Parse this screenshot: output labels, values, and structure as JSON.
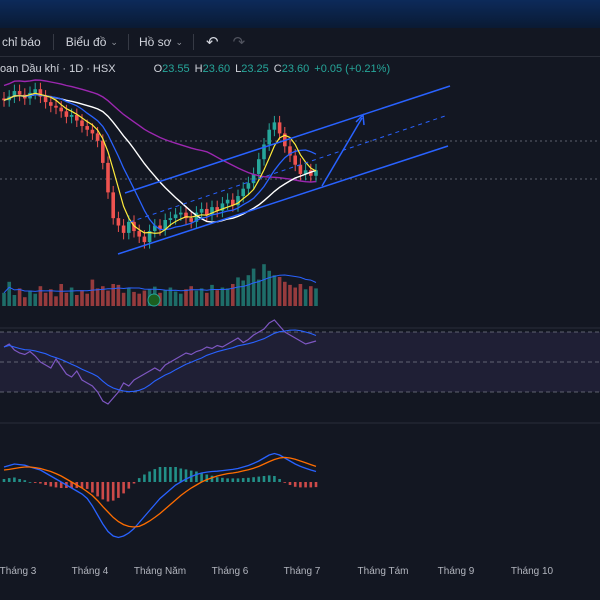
{
  "toolbar": {
    "indicators_label": "chỉ báo",
    "chart_label": "Biểu đồ",
    "profile_label": "Hồ sơ",
    "undo_icon": "undo-icon",
    "redo_icon": "redo-icon"
  },
  "legend": {
    "symbol": "oan Dầu khí · 1D · HSX",
    "o_label": "O",
    "o_value": "23.55",
    "h_label": "H",
    "h_value": "23.60",
    "l_label": "L",
    "l_value": "23.25",
    "c_label": "C",
    "c_value": "23.60",
    "change": "+0.05 (+0.21%)"
  },
  "colors": {
    "background": "#131722",
    "up": "#26a69a",
    "down": "#ef5350",
    "ma_fast": "#ffeb3b",
    "ma_mid": "#2962ff",
    "ma_slow": "#ffffff",
    "ma_long": "#9c27b0",
    "channel": "#2962ff",
    "rsi": "#7e57c2",
    "macd": "#2962ff",
    "signal": "#ff6d00"
  },
  "chart_data": {
    "type": "candlestick",
    "x_ticks": [
      "Tháng 3",
      "Tháng 4",
      "Tháng Năm",
      "Tháng 6",
      "Tháng 7",
      "Tháng Tám",
      "Tháng 9",
      "Tháng 10"
    ],
    "closes": [
      27.4,
      27.6,
      27.9,
      27.7,
      27.5,
      27.8,
      28.0,
      27.6,
      27.3,
      27.1,
      27.0,
      26.8,
      26.5,
      26.6,
      26.3,
      26.0,
      25.8,
      25.6,
      25.2,
      24.0,
      22.4,
      21.0,
      20.6,
      20.2,
      20.8,
      20.3,
      20.0,
      19.7,
      20.3,
      20.6,
      20.4,
      20.9,
      21.0,
      21.2,
      21.3,
      21.0,
      20.8,
      21.3,
      21.5,
      21.2,
      21.6,
      21.4,
      21.8,
      22.0,
      21.7,
      22.2,
      22.6,
      22.9,
      23.4,
      24.2,
      25.0,
      25.8,
      26.2,
      25.6,
      24.9,
      24.4,
      23.9,
      23.4,
      23.6,
      23.3,
      23.6
    ],
    "volume": [
      30,
      55,
      25,
      40,
      20,
      35,
      28,
      45,
      30,
      38,
      22,
      50,
      30,
      42,
      25,
      36,
      28,
      60,
      40,
      45,
      35,
      50,
      48,
      30,
      40,
      32,
      28,
      35,
      38,
      44,
      30,
      36,
      42,
      33,
      28,
      38,
      45,
      35,
      40,
      30,
      48,
      36,
      42,
      40,
      50,
      65,
      58,
      70,
      85,
      60,
      95,
      80,
      70,
      66,
      55,
      48,
      42,
      50,
      38,
      45,
      40
    ],
    "rsi": [
      60,
      62,
      58,
      56,
      55,
      57,
      54,
      50,
      48,
      46,
      52,
      47,
      42,
      40,
      44,
      38,
      36,
      34,
      30,
      24,
      22,
      26,
      30,
      36,
      34,
      38,
      40,
      42,
      44,
      46,
      44,
      48,
      50,
      52,
      54,
      56,
      55,
      57,
      58,
      60,
      59,
      61,
      60,
      62,
      64,
      66,
      63,
      65,
      68,
      70,
      72,
      76,
      78,
      74,
      70,
      68,
      66,
      64,
      62,
      63,
      64
    ],
    "macd": [
      0.5,
      0.55,
      0.6,
      0.58,
      0.56,
      0.5,
      0.45,
      0.4,
      0.3,
      0.2,
      0.1,
      0,
      -0.1,
      -0.2,
      -0.3,
      -0.4,
      -0.55,
      -0.8,
      -1.1,
      -1.4,
      -1.65,
      -1.8,
      -1.85,
      -1.8,
      -1.7,
      -1.55,
      -1.35,
      -1.15,
      -0.95,
      -0.75,
      -0.55,
      -0.4,
      -0.25,
      -0.1,
      0,
      0.1,
      0.18,
      0.25,
      0.3,
      0.33,
      0.35,
      0.36,
      0.38,
      0.4,
      0.42,
      0.45,
      0.5,
      0.55,
      0.62,
      0.7,
      0.8,
      0.9,
      0.95,
      0.9,
      0.8,
      0.7,
      0.6,
      0.52,
      0.46,
      0.4,
      0.35
    ],
    "signal": [
      0.4,
      0.42,
      0.45,
      0.48,
      0.5,
      0.5,
      0.48,
      0.45,
      0.4,
      0.35,
      0.28,
      0.2,
      0.1,
      0,
      -0.1,
      -0.2,
      -0.32,
      -0.45,
      -0.62,
      -0.82,
      -1.0,
      -1.18,
      -1.32,
      -1.42,
      -1.48,
      -1.5,
      -1.48,
      -1.4,
      -1.3,
      -1.18,
      -1.05,
      -0.9,
      -0.75,
      -0.6,
      -0.45,
      -0.32,
      -0.2,
      -0.1,
      0,
      0.08,
      0.14,
      0.2,
      0.24,
      0.28,
      0.3,
      0.33,
      0.37,
      0.41,
      0.46,
      0.52,
      0.6,
      0.68,
      0.75,
      0.8,
      0.82,
      0.8,
      0.76,
      0.7,
      0.64,
      0.58,
      0.52
    ]
  }
}
